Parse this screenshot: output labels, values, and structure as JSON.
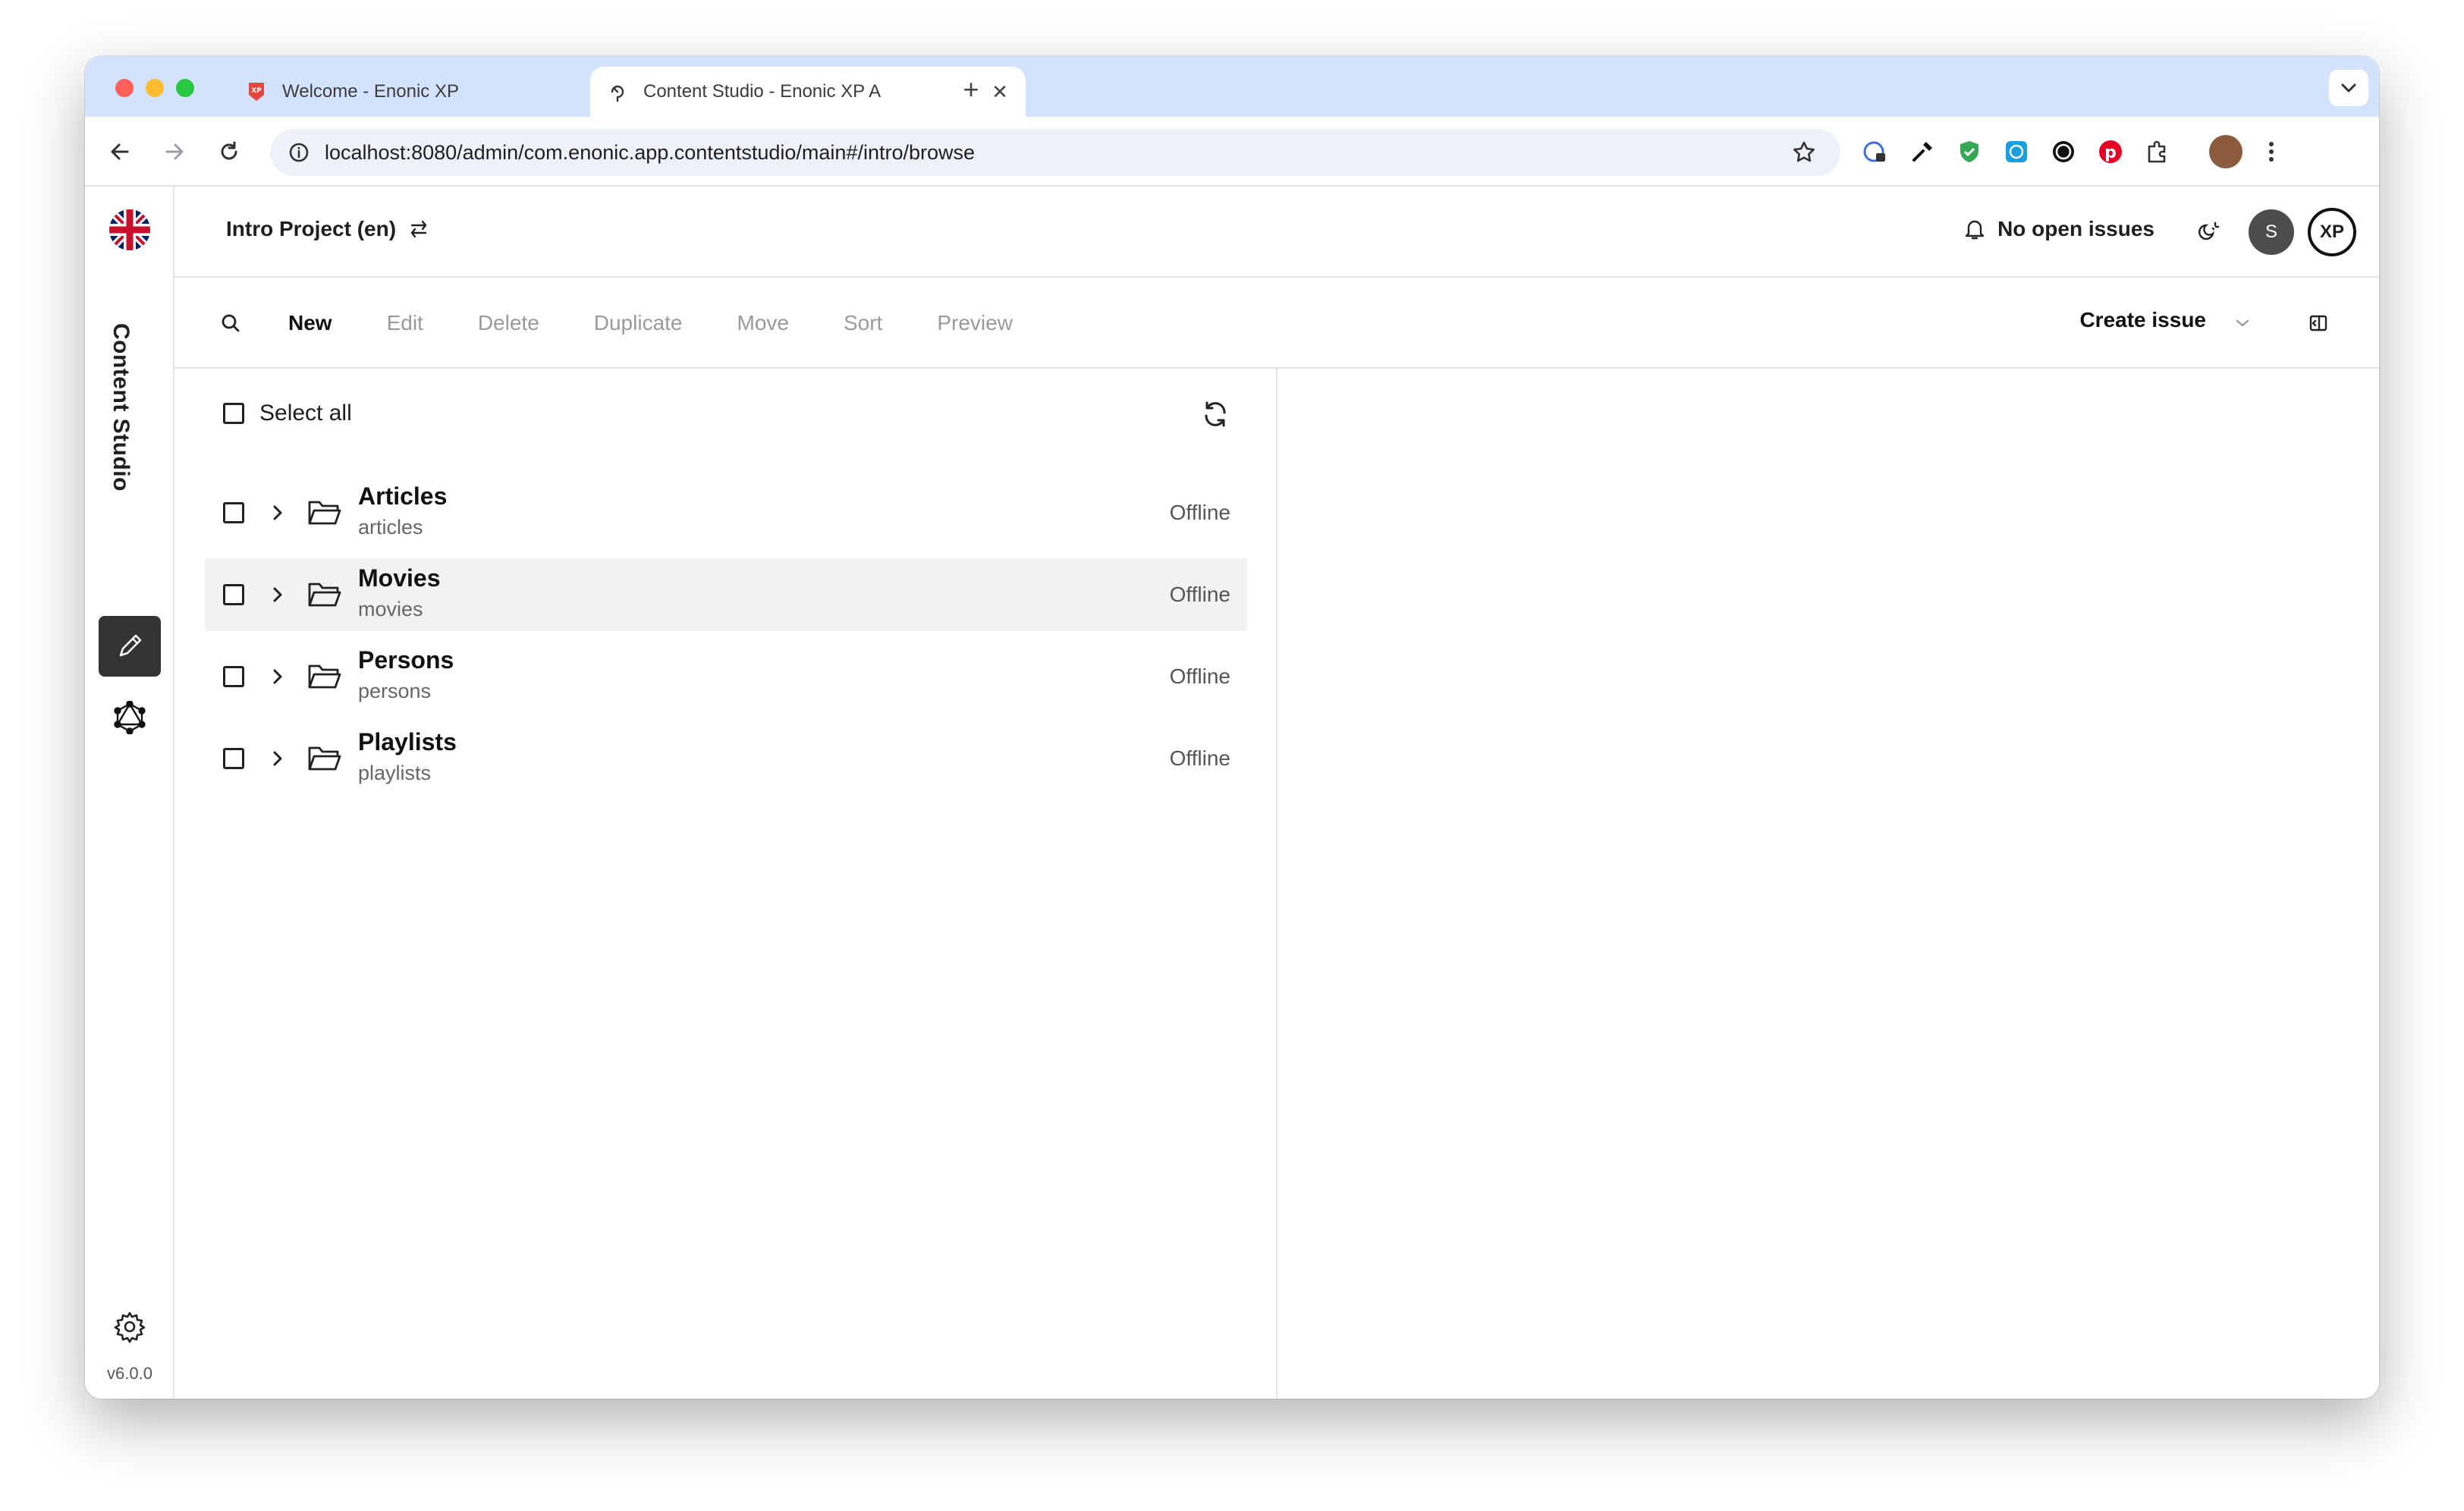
{
  "browser": {
    "tabs": [
      {
        "title": "Welcome - Enonic XP",
        "close": "✕"
      },
      {
        "title": "Content Studio - Enonic XP A",
        "close": "✕"
      }
    ],
    "new_tab": "+",
    "url": "localhost:8080/admin/com.enonic.app.contentstudio/main#/intro/browse"
  },
  "rail": {
    "title": "Content Studio",
    "version": "v6.0.0"
  },
  "header": {
    "project": "Intro Project (en)",
    "issues": "No open issues",
    "avatar_initial": "S",
    "xp_logo": "XP"
  },
  "actions": {
    "new": "New",
    "edit": "Edit",
    "delete": "Delete",
    "duplicate": "Duplicate",
    "move": "Move",
    "sort": "Sort",
    "preview": "Preview",
    "create_issue": "Create issue"
  },
  "list": {
    "select_all": "Select all",
    "items": [
      {
        "name": "Articles",
        "path": "articles",
        "status": "Offline"
      },
      {
        "name": "Movies",
        "path": "movies",
        "status": "Offline"
      },
      {
        "name": "Persons",
        "path": "persons",
        "status": "Offline"
      },
      {
        "name": "Playlists",
        "path": "playlists",
        "status": "Offline"
      }
    ]
  },
  "colors": {
    "tabstrip": "#d3e3fd",
    "active_rail": "#333333",
    "row_highlight": "#f0f2f3"
  }
}
